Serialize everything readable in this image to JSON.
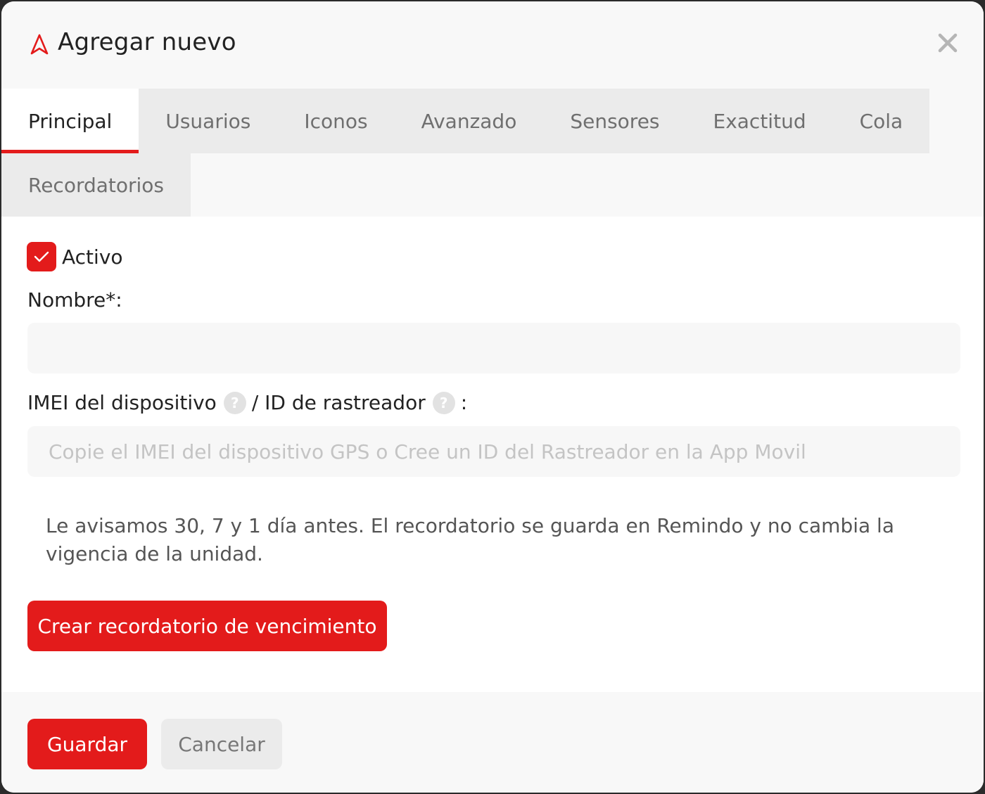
{
  "dialog": {
    "title": "Agregar nuevo",
    "accent_color": "#e31b1b"
  },
  "tabs": [
    {
      "label": "Principal",
      "active": true
    },
    {
      "label": "Usuarios"
    },
    {
      "label": "Iconos"
    },
    {
      "label": "Avanzado"
    },
    {
      "label": "Sensores"
    },
    {
      "label": "Exactitud"
    },
    {
      "label": "Cola"
    },
    {
      "label": "Recordatorios"
    }
  ],
  "form": {
    "active_label": "Activo",
    "active_checked": true,
    "name_label": "Nombre*:",
    "name_value": "",
    "imei_label": "IMEI del dispositivo",
    "tracker_label": "/ ID de rastreador",
    "imei_suffix": ":",
    "imei_placeholder": "Copie el IMEI del dispositivo GPS o Cree un ID del Rastreador en la App Movil",
    "help_glyph": "?",
    "note": "Le avisamos 30, 7 y 1 día antes. El recordatorio se guarda en Remindo y no cambia la vigencia de la unidad.",
    "reminder_button": "Crear recordatorio de vencimiento"
  },
  "footer": {
    "save_label": "Guardar",
    "cancel_label": "Cancelar"
  }
}
